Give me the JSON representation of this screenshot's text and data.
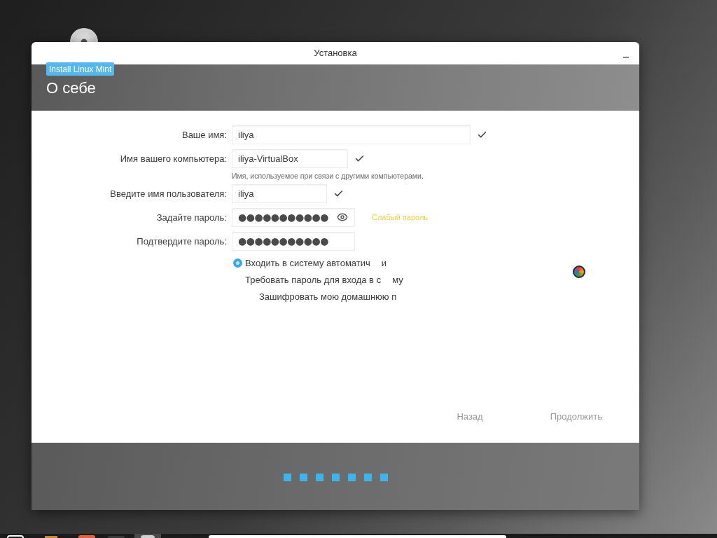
{
  "window": {
    "title": "Установка"
  },
  "header": {
    "badge": "Install Linux Mint",
    "title": "О себе"
  },
  "fields": [
    {
      "kind": "text",
      "label": "Ваше имя:",
      "value": "iliya",
      "valid": true
    },
    {
      "kind": "text",
      "label": "Имя вашего компьютера:",
      "value": "iliya-VirtualBox",
      "valid": true,
      "hint": "Имя, используемое при связи с другими компьютерами."
    },
    {
      "kind": "text",
      "label": "Введите имя пользователя:",
      "value": "iliya",
      "valid": true
    },
    {
      "kind": "password",
      "label": "Задайте пароль:",
      "value": "●●●●●●●●●●●",
      "reveal": true,
      "strength": "Слабый пароль"
    },
    {
      "kind": "password",
      "label": "Подтвердите пароль:",
      "value": "●●●●●●●●●●●"
    }
  ],
  "options": [
    {
      "kind": "radio",
      "selected": true,
      "text": "Входить в систему автоматич",
      "tail": "и"
    },
    {
      "kind": "text",
      "text": "Требовать пароль для входа в с",
      "tail": "му",
      "children": [
        {
          "kind": "text",
          "text": "Зашифровать мою домашнюю п"
        }
      ]
    }
  ],
  "buttons": [
    {
      "label": "Назад",
      "disabled": true
    },
    {
      "label": "Продолжить",
      "disabled": true
    }
  ],
  "steps": [
    {
      "done": true
    },
    {
      "done": true
    },
    {
      "done": true
    },
    {
      "done": true
    },
    {
      "done": true
    },
    {
      "done": true
    },
    {
      "done": true
    }
  ]
}
